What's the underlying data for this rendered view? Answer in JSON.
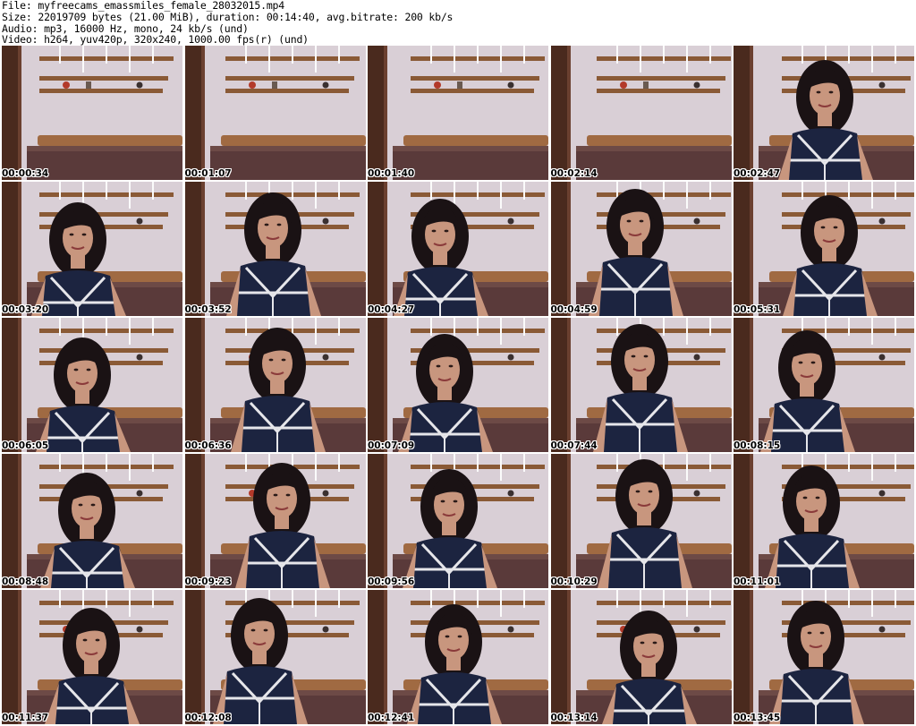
{
  "header": {
    "file_line": "File: myfreecams_emassmiles_female_28032015.mp4",
    "size_line": "Size: 22019709 bytes (21.00 MiB), duration: 00:14:40, avg.bitrate: 200 kb/s",
    "audio_line": "Audio: mp3, 16000 Hz, mono, 24 kb/s (und)",
    "video_line": "Video: h264, yuv420p, 320x240, 1000.00 fps(r) (und)"
  },
  "thumbnails": [
    {
      "time": "00:00:34",
      "person": false
    },
    {
      "time": "00:01:07",
      "person": false
    },
    {
      "time": "00:01:40",
      "person": false
    },
    {
      "time": "00:02:14",
      "person": false
    },
    {
      "time": "00:02:47",
      "person": true
    },
    {
      "time": "00:03:20",
      "person": true
    },
    {
      "time": "00:03:52",
      "person": true
    },
    {
      "time": "00:04:27",
      "person": true
    },
    {
      "time": "00:04:59",
      "person": true
    },
    {
      "time": "00:05:31",
      "person": true
    },
    {
      "time": "00:06:05",
      "person": true
    },
    {
      "time": "00:06:36",
      "person": true
    },
    {
      "time": "00:07:09",
      "person": true
    },
    {
      "time": "00:07:44",
      "person": true
    },
    {
      "time": "00:08:15",
      "person": true
    },
    {
      "time": "00:08:48",
      "person": true
    },
    {
      "time": "00:09:23",
      "person": true
    },
    {
      "time": "00:09:56",
      "person": true
    },
    {
      "time": "00:10:29",
      "person": true
    },
    {
      "time": "00:11:01",
      "person": true
    },
    {
      "time": "00:11:37",
      "person": true
    },
    {
      "time": "00:12:08",
      "person": true
    },
    {
      "time": "00:12:41",
      "person": true
    },
    {
      "time": "00:13:14",
      "person": true
    },
    {
      "time": "00:13:45",
      "person": true
    }
  ],
  "colors": {
    "wall": "#d9cfd6",
    "shelf": "#8a5a36",
    "dark_wood": "#4a2a1e",
    "headboard": "#a06a42",
    "hair": "#1a1214",
    "top": "#1c2440",
    "stripe": "#e6e6ea",
    "skin": "#c8967e",
    "bedding": "#5a3a3a"
  }
}
